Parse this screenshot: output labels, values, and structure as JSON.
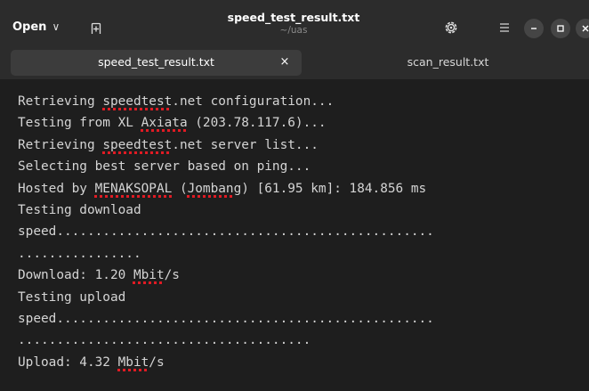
{
  "headerbar": {
    "open_label": "Open",
    "open_chevron": "∨",
    "title": "speed_test_result.txt",
    "subtitle": "~/uas",
    "icons": [
      "new-tab-icon",
      "settings-icon",
      "menu-icon",
      "minimize-icon",
      "maximize-icon",
      "close-icon"
    ]
  },
  "tabs": [
    {
      "label": "speed_test_result.txt",
      "close": "×",
      "active": true
    },
    {
      "label": "scan_result.txt",
      "active": false
    }
  ],
  "colors": {
    "background": "#1e1e1e",
    "headerbar": "#2c2c2c",
    "active_tab": "#3c3c3c",
    "text": "#d4d4d4",
    "spellcheck_underline": "#e01b24"
  },
  "editor": {
    "lines": [
      {
        "segments": [
          {
            "t": "Retrieving "
          },
          {
            "t": "speedtest",
            "sp": true
          },
          {
            "t": ".net configuration..."
          }
        ]
      },
      {
        "segments": [
          {
            "t": "Testing from XL "
          },
          {
            "t": "Axiata",
            "sp": true
          },
          {
            "t": " (203.78.117.6)..."
          }
        ]
      },
      {
        "segments": [
          {
            "t": "Retrieving "
          },
          {
            "t": "speedtest",
            "sp": true
          },
          {
            "t": ".net server list..."
          }
        ]
      },
      {
        "segments": [
          {
            "t": "Selecting best server based on ping..."
          }
        ]
      },
      {
        "segments": [
          {
            "t": "Hosted by "
          },
          {
            "t": "MENAKSOPAL",
            "sp": true
          },
          {
            "t": " ("
          },
          {
            "t": "Jombang",
            "sp": true
          },
          {
            "t": ") [61.95 km]: 184.856 ms"
          }
        ]
      },
      {
        "segments": [
          {
            "t": "Testing download"
          }
        ]
      },
      {
        "segments": [
          {
            "t": "speed................................................."
          }
        ]
      },
      {
        "segments": [
          {
            "t": "................"
          }
        ]
      },
      {
        "segments": [
          {
            "t": "Download: 1.20 "
          },
          {
            "t": "Mbit",
            "sp": true
          },
          {
            "t": "/s"
          }
        ]
      },
      {
        "segments": [
          {
            "t": "Testing upload"
          }
        ]
      },
      {
        "segments": [
          {
            "t": "speed................................................."
          }
        ]
      },
      {
        "segments": [
          {
            "t": "......................................"
          }
        ]
      },
      {
        "segments": [
          {
            "t": "Upload: 4.32 "
          },
          {
            "t": "Mbit",
            "sp": true
          },
          {
            "t": "/s"
          }
        ]
      }
    ]
  }
}
